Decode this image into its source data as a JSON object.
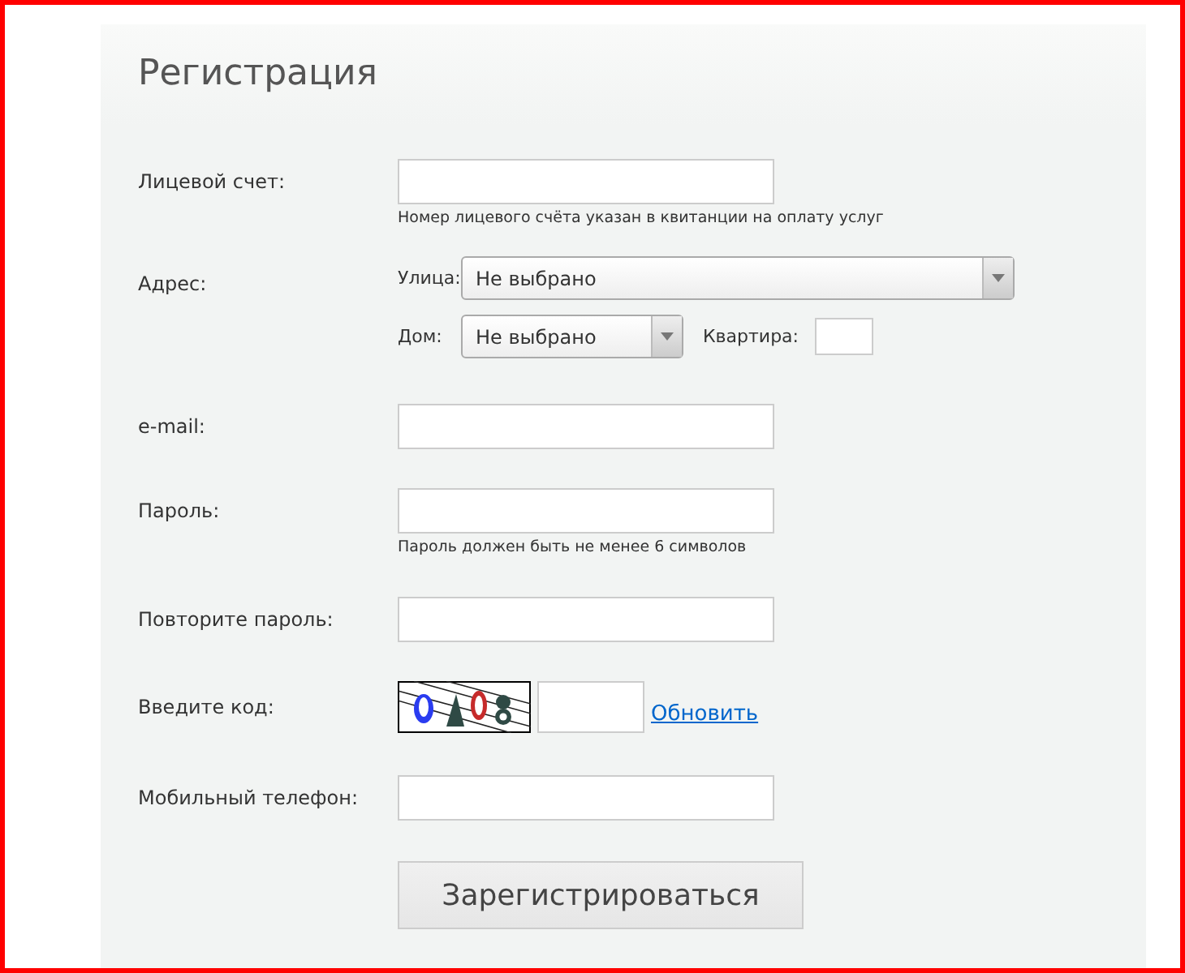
{
  "title": "Регистрация",
  "account": {
    "label": "Лицевой счет:",
    "hint": "Номер лицевого счёта указан в квитанции на оплату услуг"
  },
  "address": {
    "label": "Адрес:",
    "street_label": "Улица:",
    "street_value": "Не выбрано",
    "house_label": "Дом:",
    "house_value": "Не выбрано",
    "apartment_label": "Квартира:"
  },
  "email": {
    "label": "e-mail:"
  },
  "password": {
    "label": "Пароль:",
    "hint": "Пароль должен быть не менее 6 символов"
  },
  "password_repeat": {
    "label": "Повторите пароль:"
  },
  "captcha": {
    "label": "Введите код:",
    "refresh_link": "Обновить"
  },
  "phone": {
    "label": "Мобильный телефон:"
  },
  "submit_button": "Зарегистрироваться"
}
